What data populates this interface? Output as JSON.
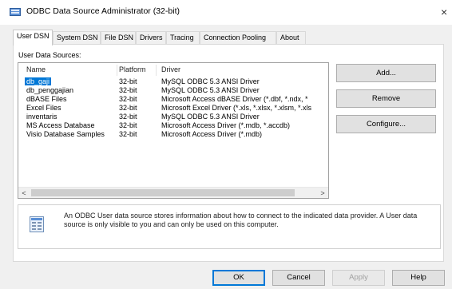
{
  "window": {
    "title": "ODBC Data Source Administrator (32-bit)",
    "close_glyph": "×"
  },
  "tabs": [
    {
      "label": "User DSN",
      "active": true
    },
    {
      "label": "System DSN"
    },
    {
      "label": "File DSN"
    },
    {
      "label": "Drivers"
    },
    {
      "label": "Tracing"
    },
    {
      "label": "Connection Pooling"
    },
    {
      "label": "About"
    }
  ],
  "user_data_sources": {
    "label": "User Data Sources:",
    "columns": [
      "Name",
      "Platform",
      "Driver"
    ],
    "rows": [
      {
        "name": "db_gaji",
        "platform": "32-bit",
        "driver": "MySQL ODBC 5.3 ANSI Driver",
        "selected": true
      },
      {
        "name": "db_penggajian",
        "platform": "32-bit",
        "driver": "MySQL ODBC 5.3 ANSI Driver"
      },
      {
        "name": "dBASE Files",
        "platform": "32-bit",
        "driver": "Microsoft Access dBASE Driver (*.dbf, *.ndx, *"
      },
      {
        "name": "Excel Files",
        "platform": "32-bit",
        "driver": "Microsoft Excel Driver (*.xls, *.xlsx, *.xlsm, *.xls"
      },
      {
        "name": "inventaris",
        "platform": "32-bit",
        "driver": "MySQL ODBC 5.3 ANSI Driver"
      },
      {
        "name": "MS Access Database",
        "platform": "32-bit",
        "driver": "Microsoft Access Driver (*.mdb, *.accdb)"
      },
      {
        "name": "Visio Database Samples",
        "platform": "32-bit",
        "driver": "Microsoft Access Driver (*.mdb)"
      }
    ],
    "scroll_left_glyph": "<",
    "scroll_right_glyph": ">"
  },
  "side_buttons": {
    "add": "Add...",
    "remove": "Remove",
    "configure": "Configure..."
  },
  "info": {
    "icon": "data-source-icon",
    "text": "An ODBC User data source stores information about how to connect to the indicated data provider.  A User data source is only visible to you and can only be used on this computer."
  },
  "bottom_buttons": {
    "ok": "OK",
    "cancel": "Cancel",
    "apply": "Apply",
    "help": "Help"
  },
  "colors": {
    "selection": "#0078d7",
    "panel": "#ffffff",
    "window_bg": "#f0f0f0"
  }
}
